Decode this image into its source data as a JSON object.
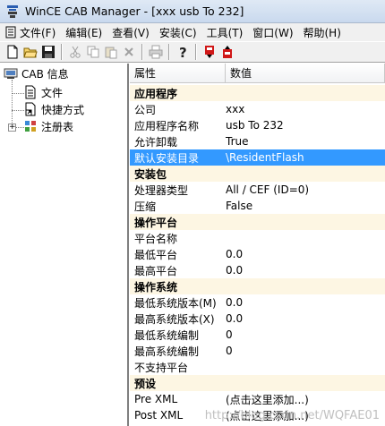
{
  "window": {
    "title": "WinCE CAB Manager - [xxx usb To 232]"
  },
  "menu": [
    {
      "label": "文件(F)",
      "icon": "doc-icon"
    },
    {
      "label": "编辑(E)"
    },
    {
      "label": "查看(V)"
    },
    {
      "label": "安装(C)"
    },
    {
      "label": "工具(T)"
    },
    {
      "label": "窗口(W)"
    },
    {
      "label": "帮助(H)"
    }
  ],
  "toolbar": [
    "new-icon",
    "open-icon",
    "save-icon",
    "cut-icon",
    "copy-icon",
    "paste-icon",
    "delete-icon",
    "print-icon",
    "help-icon",
    "install-red-icon",
    "uninstall-red-icon"
  ],
  "tree": {
    "root": "CAB 信息",
    "children": [
      {
        "label": "文件"
      },
      {
        "label": "快捷方式"
      },
      {
        "label": "注册表"
      }
    ]
  },
  "grid": {
    "headers": {
      "prop": "属性",
      "value": "数值"
    },
    "sections": [
      {
        "name": "应用程序",
        "rows": [
          {
            "k": "公司",
            "v": "xxx"
          },
          {
            "k": "应用程序名称",
            "v": "usb To 232"
          },
          {
            "k": "允许卸载",
            "v": "True"
          },
          {
            "k": "默认安装目录",
            "v": "\\ResidentFlash",
            "selected": true
          }
        ]
      },
      {
        "name": "安装包",
        "rows": [
          {
            "k": "处理器类型",
            "v": "All / CEF (ID=0)"
          },
          {
            "k": "压缩",
            "v": "False"
          }
        ]
      },
      {
        "name": "操作平台",
        "rows": [
          {
            "k": "平台名称",
            "v": ""
          },
          {
            "k": "最低平台",
            "v": "0.0"
          },
          {
            "k": "最高平台",
            "v": "0.0"
          }
        ]
      },
      {
        "name": "操作系统",
        "rows": [
          {
            "k": "最低系统版本(M)",
            "v": "0.0"
          },
          {
            "k": "最高系统版本(X)",
            "v": "0.0"
          },
          {
            "k": "最低系统编制",
            "v": "0"
          },
          {
            "k": "最高系统编制",
            "v": "0"
          },
          {
            "k": "不支持平台",
            "v": ""
          }
        ]
      },
      {
        "name": "预设",
        "rows": [
          {
            "k": "Pre XML",
            "v": "(点击这里添加...)"
          },
          {
            "k": "Post XML",
            "v": "(点击这里添加...)"
          }
        ]
      }
    ]
  },
  "watermark": "http://blog.csdn.net/WQFAE01"
}
